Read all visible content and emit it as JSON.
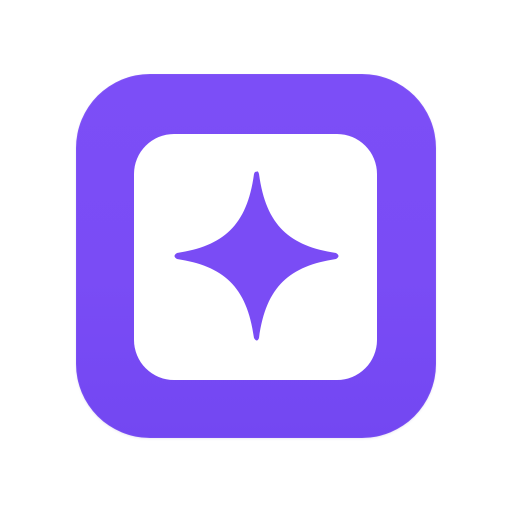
{
  "app_icon": {
    "name": "sparkle-app-icon",
    "colors": {
      "background": "#ffffff",
      "outer_tile": "#7a4cf5",
      "inner_tile": "#ffffff",
      "sparkle": "#7a4cf5"
    },
    "glyph": "four-point-star"
  }
}
